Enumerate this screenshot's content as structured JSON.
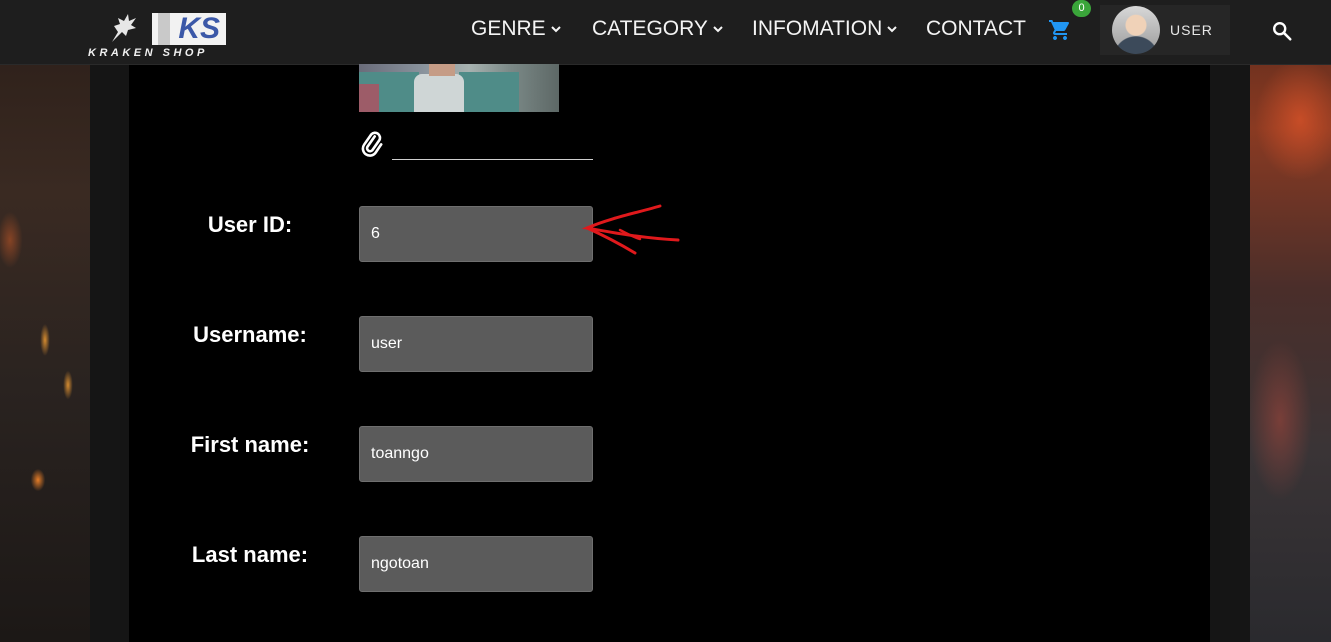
{
  "brand": {
    "logo_text": "KS",
    "name": "KRAKEN SHOP"
  },
  "nav": {
    "items": [
      {
        "label": "GENRE",
        "dropdown": true
      },
      {
        "label": "CATEGORY",
        "dropdown": true
      },
      {
        "label": "INFOMATION",
        "dropdown": true
      },
      {
        "label": "CONTACT",
        "dropdown": false
      }
    ],
    "cart_count": "0",
    "user_label": "USER"
  },
  "profile": {
    "fields": [
      {
        "label": "User ID:",
        "value": "6"
      },
      {
        "label": "Username:",
        "value": "user"
      },
      {
        "label": "First name:",
        "value": "toanngo"
      },
      {
        "label": "Last name:",
        "value": "ngotoan"
      }
    ]
  },
  "icons": {
    "cart": "shopping-cart-icon",
    "search": "search-icon",
    "attach": "paperclip-icon",
    "chevron": "chevron-down-icon"
  },
  "colors": {
    "navbar_bg": "#1e1e1e",
    "panel_bg": "#000000",
    "input_bg": "#5b5b5b",
    "cart_icon": "#2196f3",
    "cart_badge": "#3aa53a",
    "annotation_arrow": "#e0191c"
  }
}
